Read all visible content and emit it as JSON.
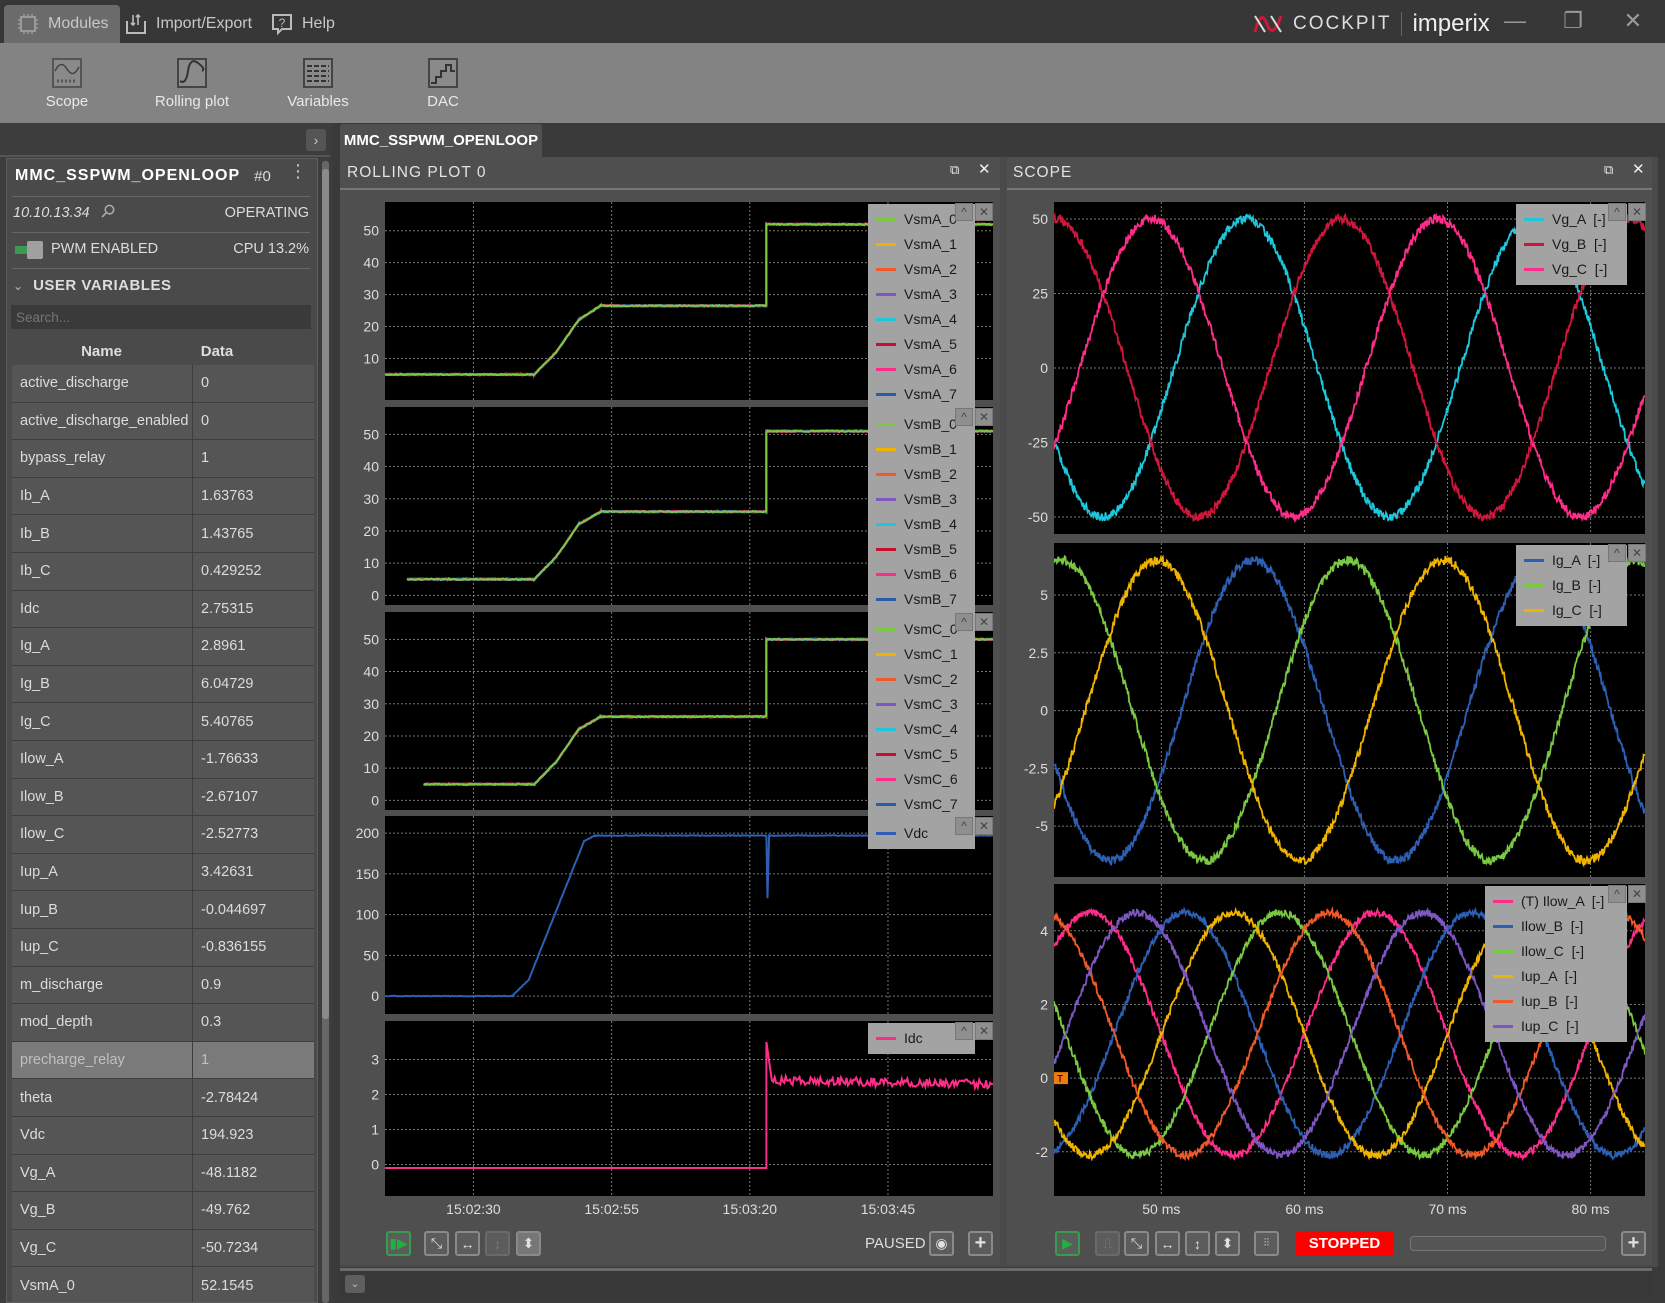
{
  "titlebar": {
    "menus": [
      {
        "label": "Modules",
        "icon": "chip-icon"
      },
      {
        "label": "Import/Export",
        "icon": "import-export-icon"
      },
      {
        "label": "Help",
        "icon": "help-icon"
      }
    ],
    "brand": "COCKPIT",
    "company": "imperix"
  },
  "ribbon": [
    {
      "label": "Scope",
      "icon": "scope-icon"
    },
    {
      "label": "Rolling plot",
      "icon": "rolling-plot-icon"
    },
    {
      "label": "Variables",
      "icon": "variables-icon"
    },
    {
      "label": "DAC",
      "icon": "dac-icon"
    }
  ],
  "tab": "MMC_SSPWM_OPENLOOP",
  "device": {
    "name": "MMC_SSPWM_OPENLOOP",
    "index": "#0",
    "ip": "10.10.13.34",
    "state": "OPERATING",
    "pwm": "PWM ENABLED",
    "cpu": "CPU 13.2%",
    "section": "USER VARIABLES",
    "search_placeholder": "Search...",
    "col_name": "Name",
    "col_data": "Data",
    "variables": [
      [
        "active_discharge",
        "0"
      ],
      [
        "active_discharge_enabled",
        "0"
      ],
      [
        "bypass_relay",
        "1"
      ],
      [
        "Ib_A",
        "1.63763"
      ],
      [
        "Ib_B",
        "1.43765"
      ],
      [
        "Ib_C",
        "0.429252"
      ],
      [
        "Idc",
        "2.75315"
      ],
      [
        "Ig_A",
        "2.8961"
      ],
      [
        "Ig_B",
        "6.04729"
      ],
      [
        "Ig_C",
        "5.40765"
      ],
      [
        "Ilow_A",
        "-1.76633"
      ],
      [
        "Ilow_B",
        "-2.67107"
      ],
      [
        "Ilow_C",
        "-2.52773"
      ],
      [
        "Iup_A",
        "3.42631"
      ],
      [
        "Iup_B",
        "-0.044697"
      ],
      [
        "Iup_C",
        "-0.836155"
      ],
      [
        "m_discharge",
        "0.9"
      ],
      [
        "mod_depth",
        "0.3"
      ],
      [
        "precharge_relay",
        "1"
      ],
      [
        "theta",
        "-2.78424"
      ],
      [
        "Vdc",
        "194.923"
      ],
      [
        "Vg_A",
        "-48.1182"
      ],
      [
        "Vg_B",
        "-49.762"
      ],
      [
        "Vg_C",
        "-50.7234"
      ],
      [
        "VsmA_0",
        "52.1545"
      ]
    ],
    "selected_variable": "precharge_relay"
  },
  "rolling": {
    "title": "ROLLING PLOT 0",
    "status": "PAUSED",
    "xlim": [
      "15:02:14",
      "15:04:04"
    ],
    "xticks": [
      "15:02:30",
      "15:02:55",
      "15:03:20",
      "15:03:45"
    ]
  },
  "scope": {
    "title": "SCOPE",
    "status": "STOPPED",
    "xlim_ms": [
      42.5,
      83.8
    ],
    "xticks": [
      "50 ms",
      "60 ms",
      "70 ms",
      "80 ms"
    ],
    "xtick_values": [
      50,
      60,
      70,
      80
    ]
  },
  "chart_data": [
    {
      "type": "line",
      "panel": "rolling",
      "ylim": [
        -3,
        59
      ],
      "yticks": [
        10,
        20,
        30,
        40,
        50
      ],
      "series": [
        {
          "name": "VsmA_0",
          "color": "#7ac943"
        },
        {
          "name": "VsmA_1",
          "color": "#f0b400"
        },
        {
          "name": "VsmA_2",
          "color": "#f05a28"
        },
        {
          "name": "VsmA_3",
          "color": "#7e57c2"
        },
        {
          "name": "VsmA_4",
          "color": "#1ec8dc"
        },
        {
          "name": "VsmA_5",
          "color": "#c8102e"
        },
        {
          "name": "VsmA_6",
          "color": "#ff2d8a"
        },
        {
          "name": "VsmA_7",
          "color": "#2a5caa"
        }
      ],
      "points": [
        [
          "15:02:14",
          5
        ],
        [
          "15:02:41",
          5
        ],
        [
          "15:02:45",
          12
        ],
        [
          "15:02:49",
          22
        ],
        [
          "15:02:53",
          26.5
        ],
        [
          "15:03:23",
          26.5
        ],
        [
          "15:03:23",
          52
        ],
        [
          "15:04:04",
          52
        ]
      ]
    },
    {
      "type": "line",
      "panel": "rolling",
      "ylim": [
        -3,
        58.5
      ],
      "yticks": [
        0,
        10,
        20,
        30,
        40,
        50
      ],
      "series": [
        {
          "name": "VsmB_0",
          "color": "#7ac943"
        },
        {
          "name": "VsmB_1",
          "color": "#f0b400"
        },
        {
          "name": "VsmB_2",
          "color": "#f05a28"
        },
        {
          "name": "VsmB_3",
          "color": "#7e57c2"
        },
        {
          "name": "VsmB_4",
          "color": "#1ec8dc"
        },
        {
          "name": "VsmB_5",
          "color": "#c8102e"
        },
        {
          "name": "VsmB_6",
          "color": "#ff2d8a"
        },
        {
          "name": "VsmB_7",
          "color": "#2a5caa"
        }
      ],
      "points": [
        [
          "15:02:18",
          5
        ],
        [
          "15:02:41",
          5
        ],
        [
          "15:02:45",
          12
        ],
        [
          "15:02:49",
          22
        ],
        [
          "15:02:53",
          26
        ],
        [
          "15:03:23",
          26
        ],
        [
          "15:03:23",
          51
        ],
        [
          "15:04:04",
          51
        ]
      ]
    },
    {
      "type": "line",
      "panel": "rolling",
      "ylim": [
        -3,
        58.5
      ],
      "yticks": [
        0,
        10,
        20,
        30,
        40,
        50
      ],
      "series": [
        {
          "name": "VsmC_0",
          "color": "#7ac943"
        },
        {
          "name": "VsmC_1",
          "color": "#f0b400"
        },
        {
          "name": "VsmC_2",
          "color": "#f05a28"
        },
        {
          "name": "VsmC_3",
          "color": "#7e57c2"
        },
        {
          "name": "VsmC_4",
          "color": "#1ec8dc"
        },
        {
          "name": "VsmC_5",
          "color": "#c8102e"
        },
        {
          "name": "VsmC_6",
          "color": "#ff2d8a"
        },
        {
          "name": "VsmC_7",
          "color": "#2a5caa"
        }
      ],
      "points": [
        [
          "15:02:21",
          5
        ],
        [
          "15:02:41",
          5
        ],
        [
          "15:02:45",
          12
        ],
        [
          "15:02:49",
          22
        ],
        [
          "15:02:53",
          26
        ],
        [
          "15:03:23",
          26
        ],
        [
          "15:03:23",
          50
        ],
        [
          "15:04:04",
          50
        ]
      ]
    },
    {
      "type": "line",
      "panel": "rolling",
      "ylim": [
        -22,
        221
      ],
      "yticks": [
        0,
        50,
        100,
        150,
        200
      ],
      "series": [
        {
          "name": "Vdc",
          "color": "#2d5fb4"
        }
      ],
      "points": [
        [
          "15:02:14",
          0
        ],
        [
          "15:02:37",
          0
        ],
        [
          "15:02:40",
          20
        ],
        [
          "15:02:50",
          190
        ],
        [
          "15:02:52",
          197
        ],
        [
          "15:03:23",
          197
        ],
        [
          "15:03:23.2",
          120
        ],
        [
          "15:03:23.5",
          197
        ],
        [
          "15:04:04",
          197
        ]
      ]
    },
    {
      "type": "line",
      "panel": "rolling",
      "ylim": [
        -0.9,
        4.1
      ],
      "yticks": [
        0,
        1,
        2,
        3
      ],
      "series": [
        {
          "name": "Idc",
          "color": "#ff2d8a"
        }
      ],
      "points": [
        [
          "15:02:14",
          -0.1
        ],
        [
          "15:03:23",
          -0.1
        ],
        [
          "15:03:23",
          3.5
        ],
        [
          "15:03:24",
          2.4
        ],
        [
          "15:04:04",
          2.3
        ]
      ]
    },
    {
      "type": "line",
      "panel": "scope",
      "ylim": [
        -55.7,
        55.7
      ],
      "yticks": [
        50,
        25,
        0,
        -25,
        -50
      ],
      "frequency_hz": 50,
      "series": [
        {
          "name": "Vg_A  [-]",
          "color": "#1ec8dc",
          "amplitude": 50,
          "offset": 0,
          "peak_time_ms": 55.9
        },
        {
          "name": "Vg_B  [-]",
          "color": "#d0163a",
          "amplitude": 50,
          "offset": 0,
          "peak_time_ms": 62.6
        },
        {
          "name": "Vg_C  [-]",
          "color": "#ff2d8a",
          "amplitude": 50,
          "offset": 0,
          "peak_time_ms": 49.3
        }
      ]
    },
    {
      "type": "line",
      "panel": "scope",
      "ylim": [
        -7.2,
        7.25
      ],
      "yticks": [
        5,
        2.5,
        0,
        -2.5,
        -5
      ],
      "frequency_hz": 50,
      "series": [
        {
          "name": "Ig_A  [-]",
          "color": "#2d5fb4",
          "amplitude": 6.5,
          "offset": 0,
          "peak_time_ms": 56.4
        },
        {
          "name": "Ig_B  [-]",
          "color": "#7ac943",
          "amplitude": 6.5,
          "offset": 0,
          "peak_time_ms": 63.0
        },
        {
          "name": "Ig_C  [-]",
          "color": "#f0b400",
          "amplitude": 6.5,
          "offset": 0,
          "peak_time_ms": 49.7
        }
      ]
    },
    {
      "type": "line",
      "panel": "scope",
      "ylim": [
        -3.2,
        5.27
      ],
      "yticks": [
        4,
        2,
        0,
        -2
      ],
      "frequency_hz": 50,
      "trigger_level": 0,
      "series": [
        {
          "name": "(T) Ilow_A  [-]",
          "color": "#ff2d8a",
          "amplitude": 3.3,
          "offset": 1.2,
          "peak_time_ms": 45.0
        },
        {
          "name": "Ilow_B  [-]",
          "color": "#2d5fb4",
          "amplitude": 3.3,
          "offset": 1.2,
          "peak_time_ms": 51.7
        },
        {
          "name": "Ilow_C  [-]",
          "color": "#7ac943",
          "amplitude": 3.3,
          "offset": 1.2,
          "peak_time_ms": 58.3
        },
        {
          "name": "Iup_A  [-]",
          "color": "#f0b400",
          "amplitude": 3.3,
          "offset": 1.2,
          "peak_time_ms": 55.0
        },
        {
          "name": "Iup_B  [-]",
          "color": "#f05a28",
          "amplitude": 3.3,
          "offset": 1.2,
          "peak_time_ms": 61.7
        },
        {
          "name": "Iup_C  [-]",
          "color": "#7e57c2",
          "amplitude": 3.3,
          "offset": 1.2,
          "peak_time_ms": 48.3
        }
      ]
    }
  ]
}
